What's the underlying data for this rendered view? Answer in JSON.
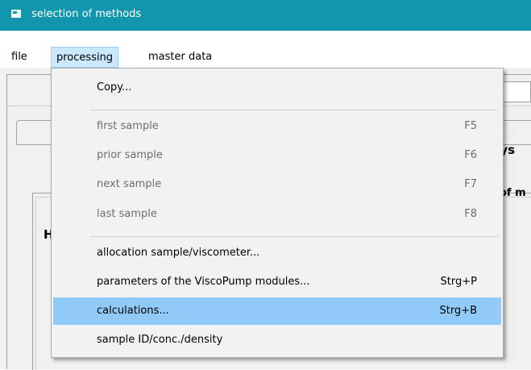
{
  "window": {
    "title": "selection of methods",
    "icon": "app-window-icon"
  },
  "menubar": {
    "items": [
      "file",
      "processing",
      "master data"
    ],
    "active": "processing"
  },
  "background_peek": {
    "text1": "rys",
    "text2": "of m",
    "text3": "H"
  },
  "dropdown": {
    "items": [
      {
        "label": "Copy...",
        "shortcut": "",
        "disabled": false
      },
      {
        "label": "first sample",
        "shortcut": "F5",
        "disabled": true
      },
      {
        "label": "prior sample",
        "shortcut": "F6",
        "disabled": true
      },
      {
        "label": "next sample",
        "shortcut": "F7",
        "disabled": true
      },
      {
        "label": "last sample",
        "shortcut": "F8",
        "disabled": true
      },
      {
        "label": "allocation sample/viscometer...",
        "shortcut": "",
        "disabled": false
      },
      {
        "label": "parameters of the ViscoPump modules...",
        "shortcut": "Strg+P",
        "disabled": false
      },
      {
        "label": "calculations...",
        "shortcut": "Strg+B",
        "disabled": false,
        "highlighted": true
      },
      {
        "label": "sample ID/conc./density",
        "shortcut": "",
        "disabled": false
      }
    ]
  },
  "colors": {
    "titlebar": "#1296ad",
    "menu_highlight": "#91c9f7",
    "menubar_active": "#cce8ff"
  }
}
